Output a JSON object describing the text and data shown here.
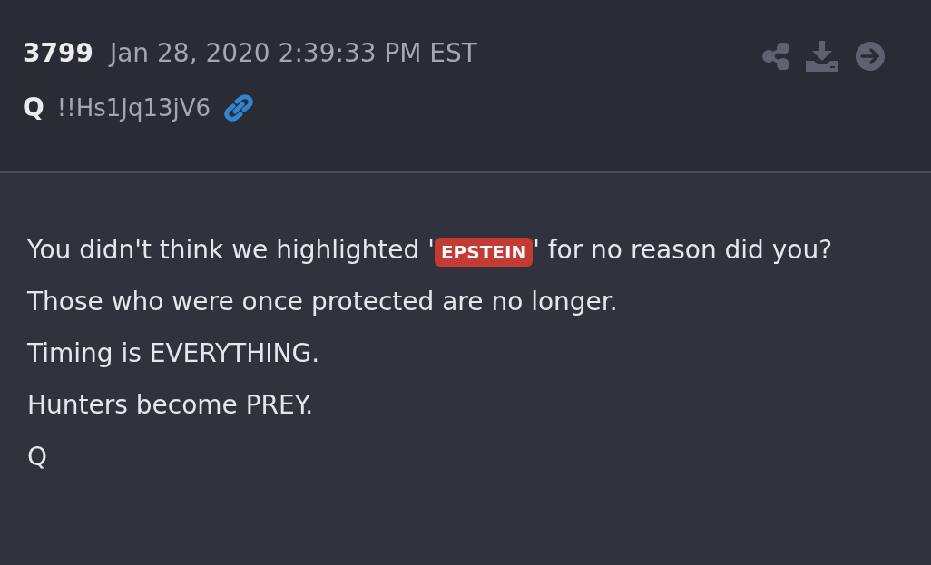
{
  "post": {
    "number": "3799",
    "timestamp": "Jan 28, 2020 2:39:33 PM EST",
    "author": "Q",
    "tripcode": "!!Hs1Jq13jV6"
  },
  "actions": [
    {
      "kind": "share"
    },
    {
      "kind": "download"
    },
    {
      "kind": "next"
    }
  ],
  "message": {
    "first_line": {
      "before": "You didn't think we highlighted '",
      "tag": "EPSTEIN",
      "after": "' for no reason did you?"
    },
    "lines": [
      "Those who were once protected are no longer.",
      "Timing is EVERYTHING.",
      "Hunters become PREY.",
      "Q"
    ]
  }
}
